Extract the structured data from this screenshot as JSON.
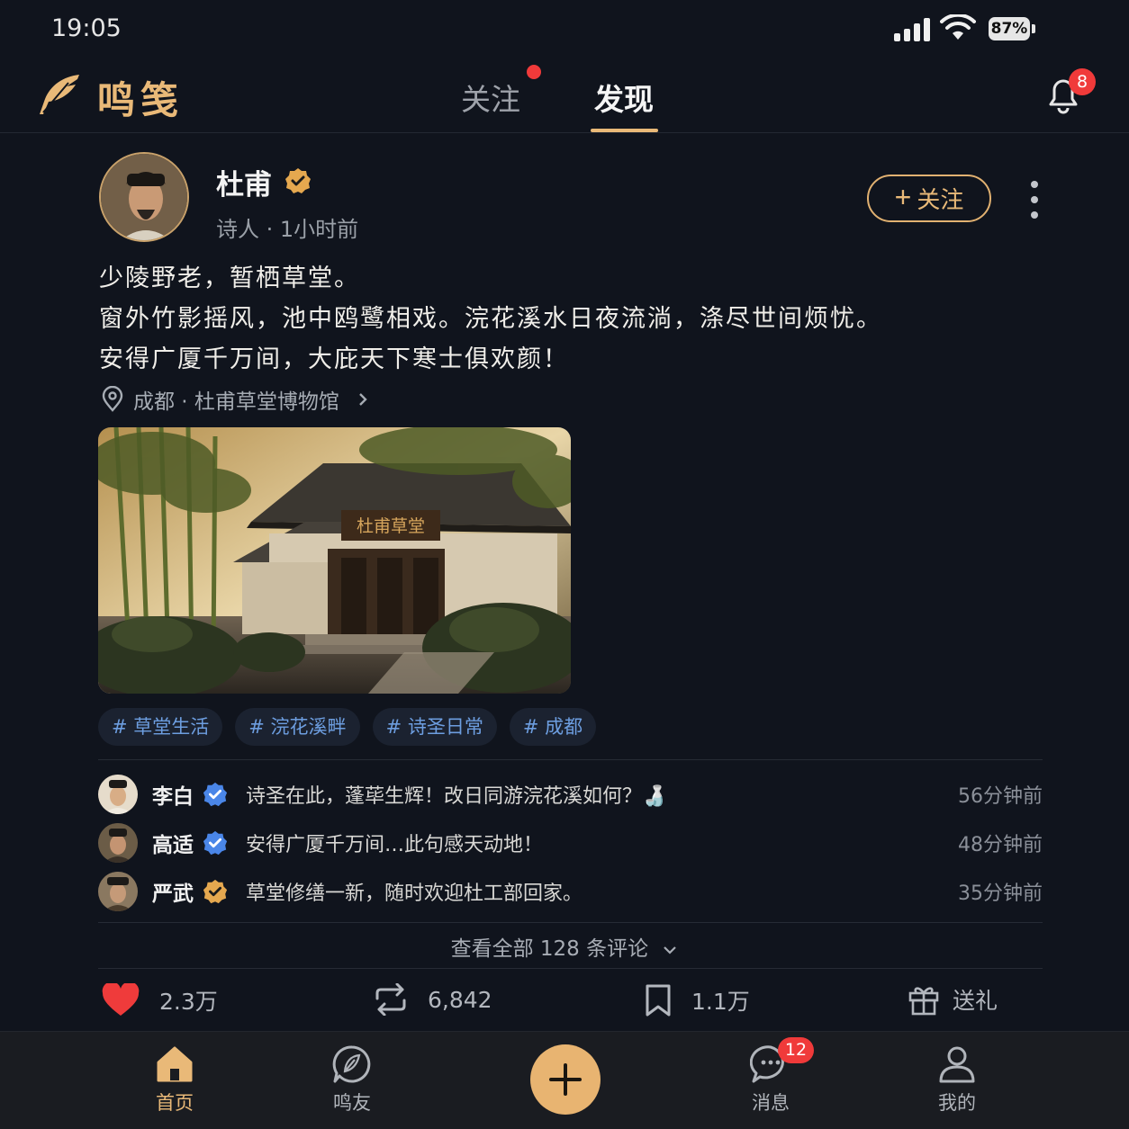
{
  "status_bar": {
    "time": "19:05",
    "battery": "87%"
  },
  "header": {
    "app_name": "鸣笺",
    "tabs": [
      {
        "label": "关注",
        "has_dot": true
      },
      {
        "label": "发现",
        "active": true
      }
    ],
    "notification_count": "8"
  },
  "post": {
    "author": {
      "name": "杜甫",
      "meta": "诗人 · 1小时前",
      "verified": true
    },
    "follow_label": "关注",
    "lines": [
      "少陵野老，暂栖草堂。",
      "窗外竹影摇风，池中鸥鹭相戏。浣花溪水日夜流淌，涤尽世间烦忧。",
      "安得广厦千万间，大庇天下寒士俱欢颜！"
    ],
    "location": "成都 · 杜甫草堂博物馆",
    "image_plaque": "杜甫草堂",
    "tags": [
      "# 草堂生活",
      "# 浣花溪畔",
      "# 诗圣日常",
      "# 成都"
    ],
    "comments": [
      {
        "name": "李白",
        "badge": "blue",
        "text": "诗圣在此，蓬荜生辉！改日同游浣花溪如何？🍶",
        "time": "56分钟前"
      },
      {
        "name": "高适",
        "badge": "blue",
        "text": "安得广厦千万间…此句感天动地！",
        "time": "48分钟前"
      },
      {
        "name": "严武",
        "badge": "gold",
        "text": "草堂修缮一新，随时欢迎杜工部回家。",
        "time": "35分钟前"
      }
    ],
    "view_all_label": "查看全部 128 条评论",
    "actions": {
      "likes": "2.3万",
      "reposts": "6,842",
      "bookmarks": "1.1万",
      "gift_label": "送礼"
    }
  },
  "bottom_nav": {
    "items": [
      {
        "label": "首页",
        "icon": "home-icon",
        "active": true
      },
      {
        "label": "鸣友",
        "icon": "feather-chat-icon"
      },
      {
        "label": "消息",
        "icon": "message-icon",
        "badge": "12"
      },
      {
        "label": "我的",
        "icon": "user-icon"
      }
    ]
  },
  "colors": {
    "accent": "#e9b978",
    "tag_text": "#6d9ee0",
    "badge_red": "#f03a3a",
    "verified_blue": "#4a86e8",
    "background": "#10141d"
  }
}
